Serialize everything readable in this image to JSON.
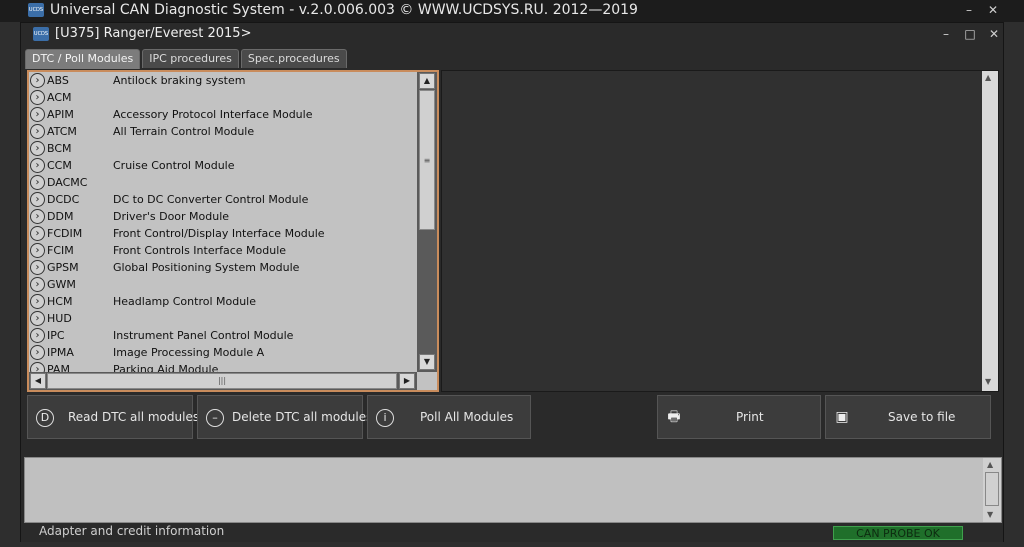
{
  "outer_window": {
    "title": "Universal CAN Diagnostic System -  v.2.0.006.003 © WWW.UCDSYS.RU. 2012—2019",
    "minimize": "–",
    "close": "✕"
  },
  "inner_window": {
    "title": "[U375] Ranger/Everest 2015>",
    "minimize": "–",
    "maximize": "□",
    "close": "✕"
  },
  "tabs": [
    {
      "label": "DTC / Poll Modules"
    },
    {
      "label": "IPC procedures"
    },
    {
      "label": "Spec.procedures"
    }
  ],
  "modules": [
    {
      "code": "ABS",
      "desc": "Antilock braking system"
    },
    {
      "code": "ACM",
      "desc": ""
    },
    {
      "code": "APIM",
      "desc": "Accessory Protocol Interface Module"
    },
    {
      "code": "ATCM",
      "desc": "All Terrain Control Module"
    },
    {
      "code": "BCM",
      "desc": ""
    },
    {
      "code": "CCM",
      "desc": "Cruise Control Module"
    },
    {
      "code": "DACMC",
      "desc": ""
    },
    {
      "code": "DCDC",
      "desc": "DC to DC Converter Control Module"
    },
    {
      "code": "DDM",
      "desc": "Driver's Door Module"
    },
    {
      "code": "FCDIM",
      "desc": "Front Control/Display Interface Module"
    },
    {
      "code": "FCIM",
      "desc": "Front Controls Interface Module"
    },
    {
      "code": "GPSM",
      "desc": "Global Positioning System Module"
    },
    {
      "code": "GWM",
      "desc": ""
    },
    {
      "code": "HCM",
      "desc": "Headlamp Control Module"
    },
    {
      "code": "HUD",
      "desc": ""
    },
    {
      "code": "IPC",
      "desc": "Instrument Panel Control Module"
    },
    {
      "code": "IPMA",
      "desc": "Image Processing Module A"
    },
    {
      "code": "PAM",
      "desc": "Parking Aid Module"
    }
  ],
  "buttons": {
    "read_dtc": "Read DTC all modules",
    "delete_dtc": "Delete DTC all modules",
    "poll_all": "Poll All Modules",
    "print": "Print",
    "save": "Save to file"
  },
  "status": {
    "adapter_text": "Adapter and credit information",
    "indicator": "CAN PROBE OK"
  },
  "colors": {
    "list_border": "#c98c5c",
    "panel_bg": "#c2c2c2"
  }
}
